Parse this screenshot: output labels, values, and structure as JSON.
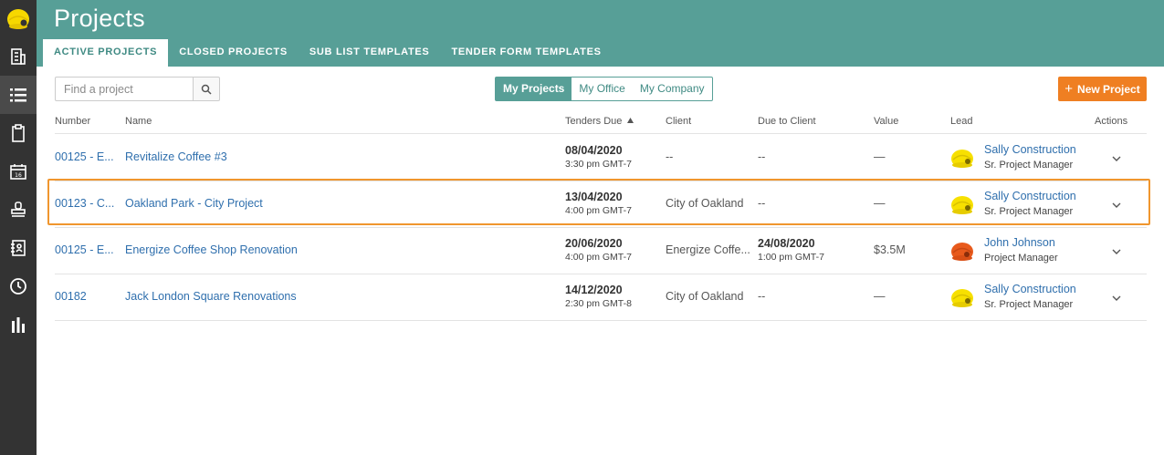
{
  "header": {
    "title": "Projects",
    "tabs": [
      "ACTIVE PROJECTS",
      "CLOSED PROJECTS",
      "SUB LIST TEMPLATES",
      "TENDER FORM TEMPLATES"
    ]
  },
  "sidebar": {
    "icons": [
      "hardhat-logo-icon",
      "building-icon",
      "list-icon",
      "clipboard-icon",
      "calendar-icon",
      "stamp-icon",
      "contacts-book-icon",
      "clock-icon",
      "bar-chart-icon"
    ],
    "active": "list-icon"
  },
  "search": {
    "placeholder": "Find a project",
    "value": ""
  },
  "filters": [
    "My Projects",
    "My Office",
    "My Company"
  ],
  "new_project_label": "New Project",
  "table": {
    "columns": [
      "Number",
      "Name",
      "Tenders Due",
      "Client",
      "Due to Client",
      "Value",
      "Lead",
      "Actions"
    ],
    "rows": [
      {
        "number": "00125 - E...",
        "name": "Revitalize Coffee #3",
        "tender_date": "08/04/2020",
        "tender_time": "3:30 pm GMT-7",
        "client": "--",
        "due_date": "--",
        "due_time": "",
        "value": "—",
        "lead_name": "Sally Construction",
        "lead_role": "Sr. Project Manager",
        "lead_avatar": "yellow-hardhat-avatar"
      },
      {
        "number": "00123 - C...",
        "name": "Oakland Park - City Project",
        "tender_date": "13/04/2020",
        "tender_time": "4:00 pm GMT-7",
        "client": "City of Oakland",
        "due_date": "--",
        "due_time": "",
        "value": "—",
        "lead_name": "Sally Construction",
        "lead_role": "Sr. Project Manager",
        "lead_avatar": "yellow-hardhat-avatar"
      },
      {
        "number": "00125 - E...",
        "name": "Energize Coffee Shop Renovation",
        "tender_date": "20/06/2020",
        "tender_time": "4:00 pm GMT-7",
        "client": "Energize Coffe...",
        "due_date": "24/08/2020",
        "due_time": "1:00 pm GMT-7",
        "value": "$3.5M",
        "lead_name": "John Johnson",
        "lead_role": "Project Manager",
        "lead_avatar": "orange-hardhat-avatar"
      },
      {
        "number": "00182",
        "name": "Jack London Square Renovations",
        "tender_date": "14/12/2020",
        "tender_time": "2:30 pm GMT-8",
        "client": "City of Oakland",
        "due_date": "--",
        "due_time": "",
        "value": "—",
        "lead_name": "Sally Construction",
        "lead_role": "Sr. Project Manager",
        "lead_avatar": "yellow-hardhat-avatar"
      }
    ],
    "highlighted_row": 1
  },
  "colors": {
    "header": "#579f97",
    "sidebar": "#333333",
    "accent_orange": "#ef7f22",
    "link": "#2f6fad",
    "highlight": "#f0962e"
  }
}
